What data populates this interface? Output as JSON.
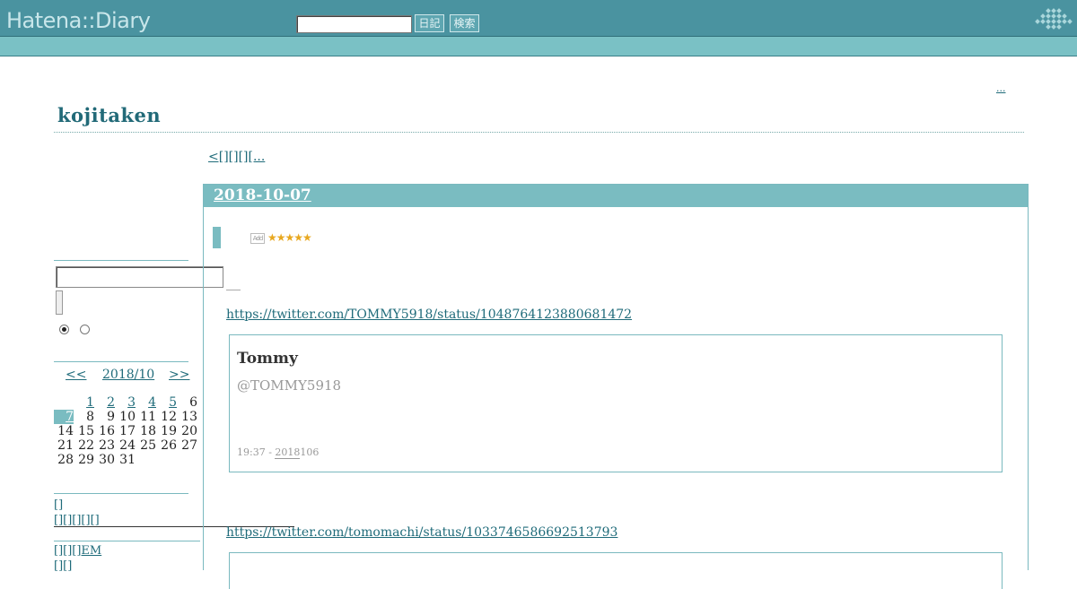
{
  "header": {
    "logo": "Hatena::Diary",
    "search_placeholder": "",
    "diary_button": "日記",
    "search_button": "検索"
  },
  "corner_link": "...",
  "blog": {
    "title": "kojitaken",
    "prev_link": "<[][][][..."
  },
  "entry": {
    "date": "2018-10-07",
    "stars": "★★★★★",
    "star_add": "Add",
    "tweets": [
      {
        "url": "https://twitter.com/TOMMY5918/status/1048764123880681472",
        "name": "Tommy",
        "handle": "@TOMMY5918",
        "time": "19:37 - ",
        "date_link": "2018",
        "date_rest": "106"
      },
      {
        "url": "https://twitter.com/tomomachi/status/1033746586692513793"
      }
    ]
  },
  "sidebar": {
    "calendar": {
      "prev": "<<",
      "month": "2018/10",
      "next": ">>",
      "today": "7",
      "linked_days": [
        "1",
        "2",
        "3",
        "4",
        "5",
        "7"
      ],
      "weeks": [
        [
          "",
          "",
          "1",
          "2",
          "3",
          "4",
          "5",
          "6"
        ],
        [
          "7",
          "8",
          "9",
          "10",
          "11",
          "12",
          "13"
        ],
        [
          "14",
          "15",
          "16",
          "17",
          "18",
          "19",
          "20"
        ],
        [
          "21",
          "22",
          "23",
          "24",
          "25",
          "26",
          "27"
        ],
        [
          "28",
          "29",
          "30",
          "31",
          "",
          "",
          ""
        ]
      ]
    },
    "links": [
      "[]",
      "[][][][][]",
      "[][][]EM",
      "[][]"
    ]
  },
  "colors": {
    "header_bg": "#4a93a0",
    "subbar_bg": "#7ac1c5",
    "accent": "#7abcc1",
    "link": "#1f6b7a"
  }
}
